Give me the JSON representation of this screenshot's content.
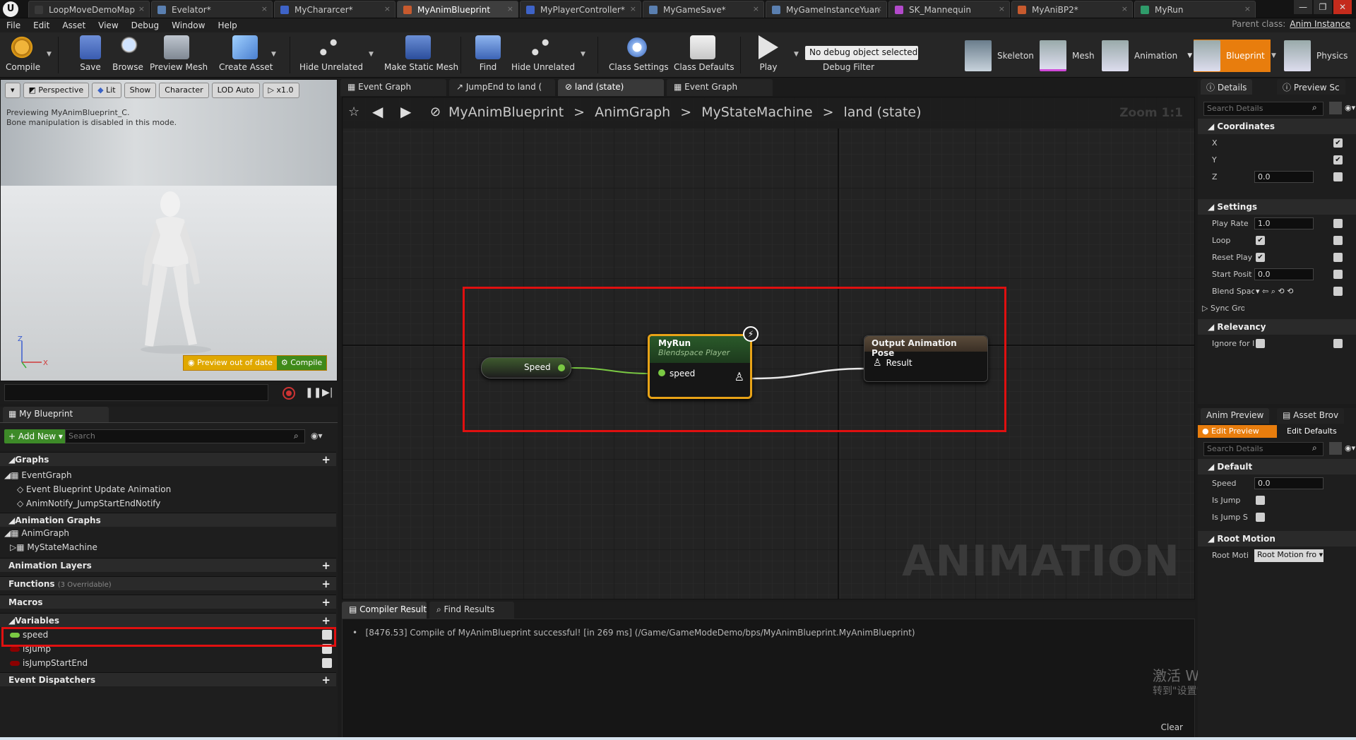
{
  "title_bar": {
    "logo": "U",
    "tabs": [
      {
        "label": "LoopMoveDemoMap",
        "icon": "level-icon",
        "color": "#3a3a3a"
      },
      {
        "label": "Evelator*",
        "icon": "blueprint-icon",
        "color": "#5a7fb0"
      },
      {
        "label": "MyChararcer*",
        "icon": "blueprint-icon",
        "color": "#3e63c7"
      },
      {
        "label": "MyAnimBlueprint",
        "icon": "anim-blueprint-icon",
        "color": "#c75a2e"
      },
      {
        "label": "MyPlayerController*",
        "icon": "blueprint-icon",
        "color": "#3e63c7"
      },
      {
        "label": "MyGameSave*",
        "icon": "blueprint-icon",
        "color": "#5a7fb0"
      },
      {
        "label": "MyGameInstanceYuan",
        "icon": "blueprint-icon",
        "color": "#5a7fb0"
      },
      {
        "label": "SK_Mannequin",
        "icon": "skeletal-mesh-icon",
        "color": "#b34acb"
      },
      {
        "label": "MyAniBP2*",
        "icon": "anim-blueprint-icon",
        "color": "#c75a2e"
      },
      {
        "label": "MyRun",
        "icon": "blendspace-icon",
        "color": "#2f9b6a"
      }
    ],
    "active_tab": 3
  },
  "menu": [
    "File",
    "Edit",
    "Asset",
    "View",
    "Debug",
    "Window",
    "Help"
  ],
  "parent_class": {
    "label": "Parent class:",
    "value": "Anim Instance"
  },
  "toolbar": {
    "compile": "Compile",
    "save": "Save",
    "browse": "Browse",
    "preview_mesh": "Preview Mesh",
    "create_asset": "Create Asset",
    "hide_unrelated_1": "Hide Unrelated",
    "make_static_mesh": "Make Static Mesh",
    "find": "Find",
    "hide_unrelated_2": "Hide Unrelated",
    "class_settings": "Class Settings",
    "class_defaults": "Class Defaults",
    "play": "Play",
    "debug_select": "No debug object selected",
    "debug_filter": "Debug Filter",
    "modes": [
      "Skeleton",
      "Mesh",
      "Animation",
      "Blueprint",
      "Physics"
    ],
    "active_mode": "Blueprint"
  },
  "viewport": {
    "buttons": [
      "Perspective",
      "Lit",
      "Show",
      "Character",
      "LOD Auto",
      "x1.0"
    ],
    "message_1": "Previewing MyAnimBlueprint_C.",
    "message_2": "Bone manipulation is disabled in this mode.",
    "preview_status": "Preview out of date",
    "compile_button": "Compile",
    "axis_z": "Z",
    "axis_x": "X"
  },
  "my_blueprint": {
    "tab": "My Blueprint",
    "add_new": "+ Add New",
    "search_placeholder": "Search",
    "graphs": "Graphs",
    "event_graph": "EventGraph",
    "event_update": "Event Blueprint Update Animation",
    "anim_notify": "AnimNotify_JumpStartEndNotify",
    "animation_graphs": "Animation Graphs",
    "anim_graph": "AnimGraph",
    "state_machine": "MyStateMachine",
    "animation_layers": "Animation Layers",
    "functions": "Functions",
    "functions_sub": "(3 Overridable)",
    "macros": "Macros",
    "variables": "Variables",
    "vars": [
      {
        "name": "speed",
        "color": "#7ac943"
      },
      {
        "name": "isJump",
        "color": "#8b0000"
      },
      {
        "name": "isJumpStartEnd",
        "color": "#8b0000"
      }
    ],
    "event_dispatchers": "Event Dispatchers"
  },
  "graph": {
    "tabs": [
      "Event Graph",
      "JumpEnd to land (",
      "land (state)",
      "Event Graph"
    ],
    "active_tab": 2,
    "breadcrumbs": [
      "MyAnimBlueprint",
      "AnimGraph",
      "MyStateMachine",
      "land (state)"
    ],
    "zoom": "Zoom 1:1",
    "watermark": "ANIMATION",
    "speed_node": "Speed",
    "myrun_title": "MyRun",
    "myrun_subtitle": "Blendspace Player",
    "myrun_pin": "speed",
    "output_title": "Output Animation Pose",
    "output_pin": "Result"
  },
  "output": {
    "tabs": [
      "Compiler Results",
      "Find Results"
    ],
    "message": "[8476.53] Compile of MyAnimBlueprint successful! [in 269 ms] (/Game/GameModeDemo/bps/MyAnimBlueprint.MyAnimBlueprint)",
    "clear": "Clear"
  },
  "windows_watermark": {
    "line1": "激活 Windows",
    "line2": "转到\"设置\"以激活 Windows。"
  },
  "details": {
    "tabs": [
      "Details",
      "Preview Sc"
    ],
    "search_placeholder": "Search Details",
    "coordinates": "Coordinates",
    "x": "X",
    "y": "Y",
    "z": "Z",
    "z_value": "0.0",
    "settings": "Settings",
    "play_rate": "Play Rate",
    "play_rate_value": "1.0",
    "loop": "Loop",
    "reset_play": "Reset Play",
    "start_pos": "Start Posit",
    "start_pos_value": "0.0",
    "blend_space": "Blend Spac",
    "sync_group": "Sync Group",
    "relevancy": "Relevancy",
    "ignore_for": "Ignore for I"
  },
  "anim_preview": {
    "tabs": [
      "Anim Preview",
      "Asset Brov"
    ],
    "edit_preview": "Edit Preview",
    "edit_defaults": "Edit Defaults",
    "search_placeholder": "Search Details",
    "default": "Default",
    "speed": "Speed",
    "speed_value": "0.0",
    "is_jump": "Is Jump",
    "is_jump_s": "Is Jump S",
    "root_motion": "Root Motion",
    "root_motion_label": "Root Moti",
    "root_motion_value": "Root Motion fro"
  }
}
